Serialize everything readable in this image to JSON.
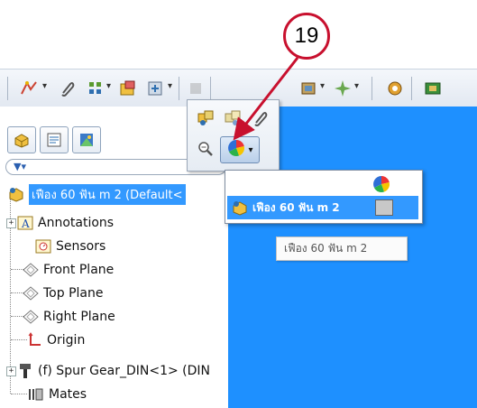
{
  "callout": {
    "number": "19",
    "color": "#c8102e"
  },
  "colors": {
    "viewport": "#1e90ff",
    "selection": "#3399ff"
  },
  "toolbar": {
    "icons": [
      "sketch-icon",
      "paperclip-icon",
      "pattern-icon",
      "assembly-icon",
      "insert-icon",
      "mate-icon",
      "explode-icon",
      "spark-icon",
      "gear-icon",
      "render-icon"
    ]
  },
  "panel": {
    "tabs": [
      "feature-manager-tab",
      "property-manager-tab",
      "display-manager-tab"
    ],
    "filter_icon": "filter-icon",
    "tree": [
      {
        "name": "root",
        "label": "เฟือง 60 ฟัน m 2  (Default<",
        "icon": "assembly-icon"
      },
      {
        "name": "annotations",
        "label": "Annotations",
        "icon": "annotation-icon"
      },
      {
        "name": "sensors",
        "label": "Sensors",
        "icon": "sensor-icon"
      },
      {
        "name": "front-plane",
        "label": "Front Plane",
        "icon": "plane-icon"
      },
      {
        "name": "top-plane",
        "label": "Top Plane",
        "icon": "plane-icon"
      },
      {
        "name": "right-plane",
        "label": "Right Plane",
        "icon": "plane-icon"
      },
      {
        "name": "origin",
        "label": "Origin",
        "icon": "origin-icon"
      },
      {
        "name": "spur-gear",
        "label": "(f) Spur Gear_DIN<1> (DIN",
        "icon": "component-icon"
      },
      {
        "name": "mates",
        "label": "Mates",
        "icon": "mates-icon"
      }
    ]
  },
  "popup": {
    "buttons": [
      "assembly-view-icon",
      "assembly-hide-icon",
      "paperclip-icon",
      "zoom-icon",
      "appearance-icon"
    ]
  },
  "menu": {
    "header_icon": "appearance-ball-icon",
    "item_label": "เฟือง 60 ฟัน m 2"
  },
  "tooltip": {
    "text": "เฟือง 60 ฟัน m 2"
  }
}
